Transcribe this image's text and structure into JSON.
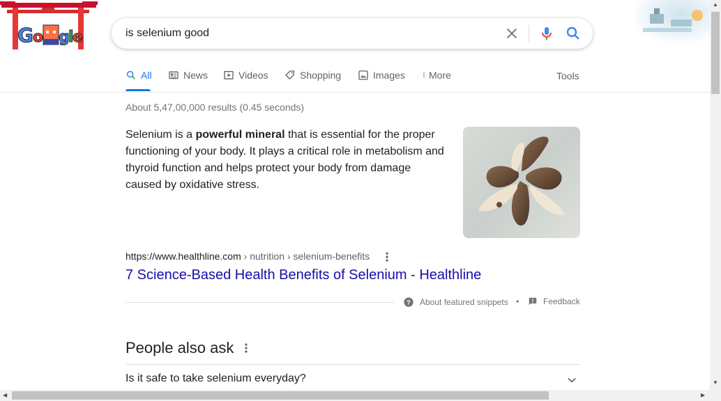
{
  "search": {
    "query": "is selenium good"
  },
  "tabs": [
    {
      "label": "All",
      "icon": "search-icon",
      "active": true
    },
    {
      "label": "News",
      "icon": "news-icon"
    },
    {
      "label": "Videos",
      "icon": "video-icon"
    },
    {
      "label": "Shopping",
      "icon": "tag-icon"
    },
    {
      "label": "Images",
      "icon": "image-icon"
    },
    {
      "label": "More",
      "icon": "more-vert-icon"
    }
  ],
  "tools_label": "Tools",
  "result_stats": "About 5,47,00,000 results (0.45 seconds)",
  "featured_snippet": {
    "text_before": "Selenium is a ",
    "bold": "powerful mineral",
    "text_after": " that is essential for the proper functioning of your body. It plays a critical role in metabolism and thyroid function and helps protect your body from damage caused by oxidative stress.",
    "cite_domain": "https://www.healthline.com",
    "cite_path": " › nutrition › selenium-benefits",
    "link_title": "7 Science-Based Health Benefits of Selenium - Healthline",
    "about_label": "About featured snippets",
    "separator": "•",
    "feedback_label": "Feedback"
  },
  "people_also_ask": {
    "title": "People also ask",
    "questions": [
      "Is it safe to take selenium everyday?"
    ]
  },
  "colors": {
    "accent": "#1a73e8",
    "link": "#1a0dab",
    "muted": "#70757a"
  },
  "logo_text": "Google"
}
